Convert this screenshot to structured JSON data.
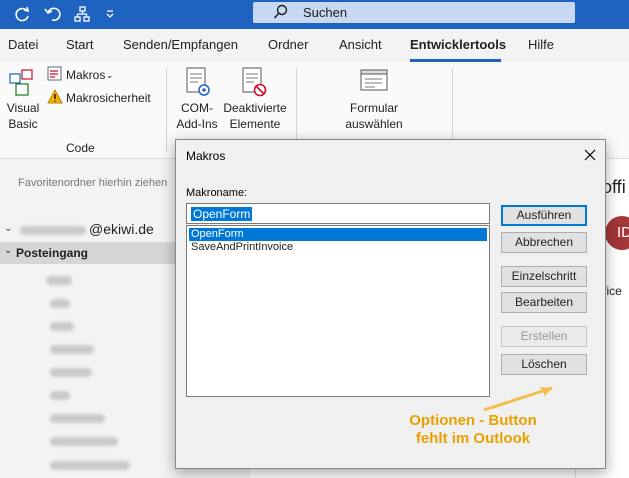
{
  "titlebar": {
    "search_label": "Suchen"
  },
  "menu": {
    "items": [
      "Datei",
      "Start",
      "Senden/Empfangen",
      "Ordner",
      "Ansicht",
      "Entwicklertools",
      "Hilfe"
    ],
    "active_index": 5
  },
  "ribbon": {
    "visual_basic": "Visual\nBasic",
    "macros": "Makros",
    "macro_security": "Makrosicherheit",
    "code_group": "Code",
    "com_addins": "COM-\nAdd-Ins",
    "disabled_items": "Deaktivierte\nElemente",
    "choose_form": "Formular\nauswählen"
  },
  "left_pane": {
    "favorites_hint": "Favoritenordner hierhin ziehen",
    "account_suffix": "@ekiwi.de",
    "inbox": "Posteingang"
  },
  "right_pane": {
    "fragment_1": "offi",
    "avatar_initials": "ID",
    "fragment_2": "ffice"
  },
  "dialog": {
    "title": "Makros",
    "macro_name_label": "Makroname:",
    "macro_name_value": "OpenForm",
    "macro_list": [
      "OpenForm",
      "SaveAndPrintInvoice"
    ],
    "selected_index": 0,
    "buttons": {
      "run": "Ausführen",
      "cancel": "Abbrechen",
      "step_into": "Einzelschritt",
      "edit": "Bearbeiten",
      "create": "Erstellen",
      "delete": "Löschen"
    }
  },
  "annotation": {
    "line1": "Optionen - Button",
    "line2": "fehlt im Outlook",
    "color": "#e8a100"
  },
  "colors": {
    "titlebar": "#1f63c0",
    "accent": "#0078d7"
  }
}
